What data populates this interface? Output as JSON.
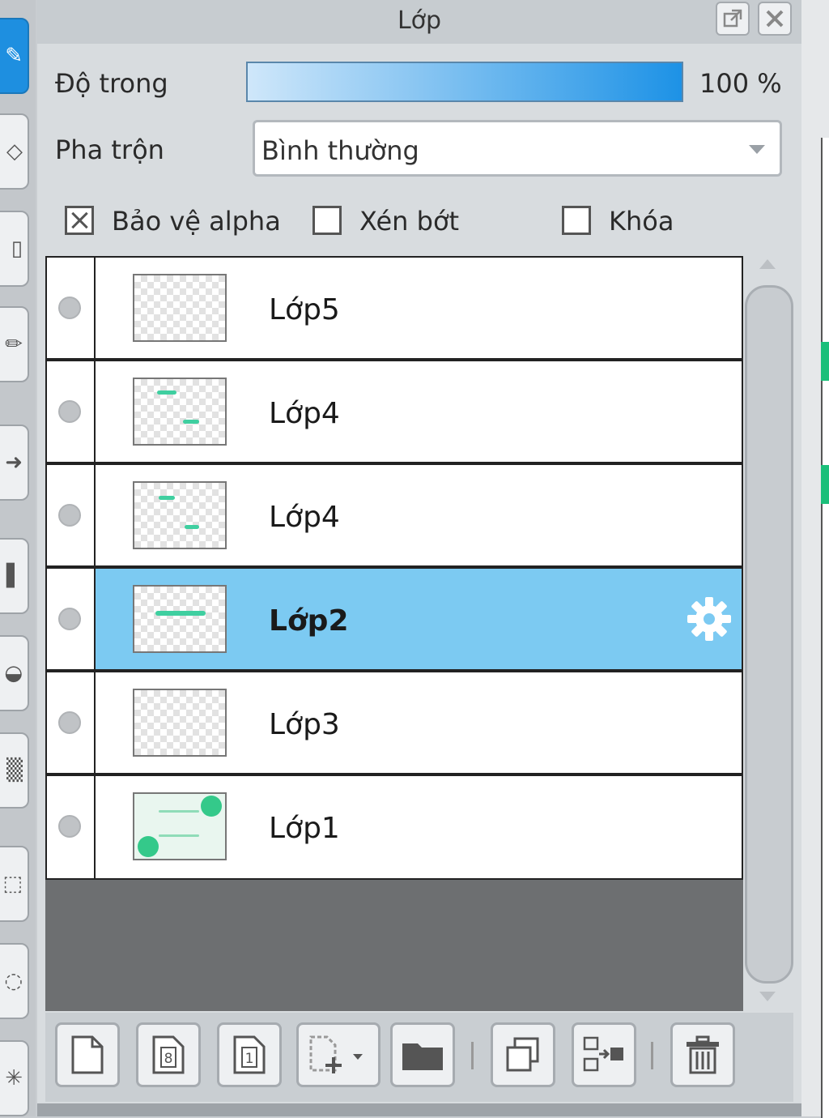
{
  "panel": {
    "title": "Lớp",
    "opacity_label": "Độ trong",
    "opacity_value": "100 %",
    "opacity_fraction": 1.0,
    "blend_label": "Pha trộn",
    "blend_value": "Bình thường",
    "checkboxes": [
      {
        "label": "Bảo vệ alpha",
        "checked": true
      },
      {
        "label": "Xén bớt",
        "checked": false
      },
      {
        "label": "Khóa",
        "checked": false
      }
    ]
  },
  "layers": [
    {
      "name": "Lớp5",
      "selected": false
    },
    {
      "name": "Lớp4",
      "selected": false
    },
    {
      "name": "Lớp4",
      "selected": false
    },
    {
      "name": "Lớp2",
      "selected": true
    },
    {
      "name": "Lớp3",
      "selected": false
    },
    {
      "name": "Lớp1",
      "selected": false
    }
  ],
  "bottom_toolbar": {
    "page_8": "8",
    "page_1": "1"
  },
  "colors": {
    "selection": "#7ccaf2",
    "active_tool": "#1e8fe0",
    "accent_green": "#34c98a"
  }
}
